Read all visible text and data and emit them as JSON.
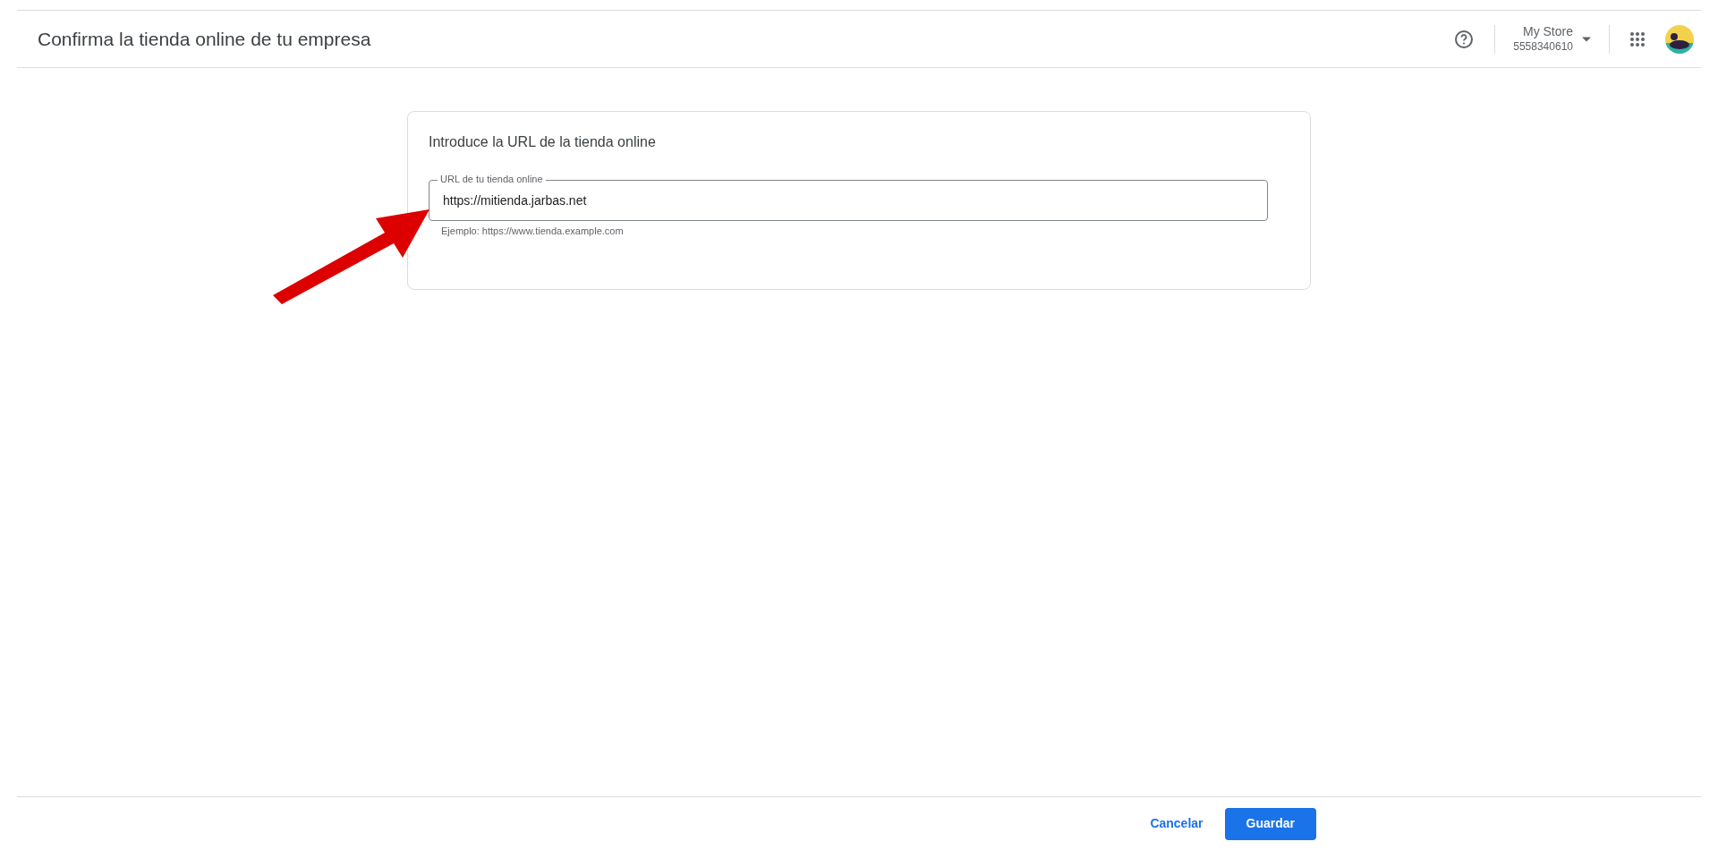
{
  "header": {
    "title": "Confirma la tienda online de tu empresa",
    "account": {
      "name": "My Store",
      "id": "5558340610"
    }
  },
  "card": {
    "title": "Introduce la URL de la tienda online",
    "field": {
      "label": "URL de tu tienda online",
      "value": "https://mitienda.jarbas.net",
      "hint": "Ejemplo: https://www.tienda.example.com"
    }
  },
  "footer": {
    "buttons": [
      {
        "label": "Cancelar",
        "kind": "text"
      },
      {
        "label": "Guardar",
        "kind": "primary"
      }
    ]
  }
}
